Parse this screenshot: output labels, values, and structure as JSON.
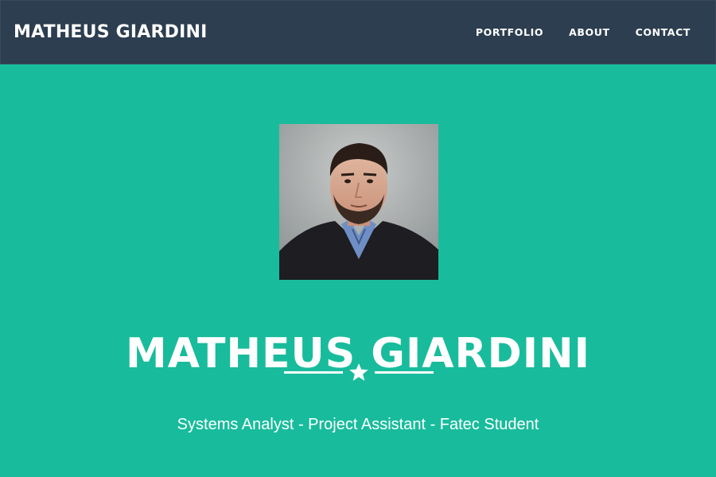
{
  "header": {
    "brand": "MATHEUS GIARDINI",
    "nav": [
      {
        "label": "PORTFOLIO"
      },
      {
        "label": "ABOUT"
      },
      {
        "label": "CONTACT"
      }
    ]
  },
  "hero": {
    "name": "MATHEUS GIARDINI",
    "subtitle": "Systems Analyst - Project Assistant - Fatec Student",
    "divider_icon": "star-icon"
  },
  "colors": {
    "navbar": "#2c3e50",
    "hero_background": "#18bc9c",
    "text": "#ffffff"
  }
}
